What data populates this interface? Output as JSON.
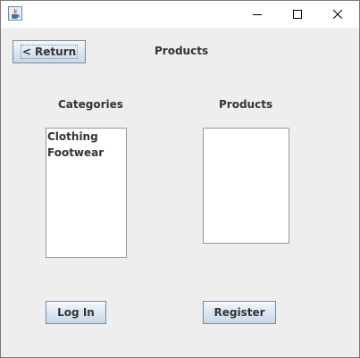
{
  "window": {
    "title": ""
  },
  "header": {
    "return_label": "< Return",
    "title": "Products"
  },
  "categories": {
    "label": "Categories",
    "items": [
      "Clothing",
      "Footwear"
    ]
  },
  "products": {
    "label": "Products",
    "items": []
  },
  "footer": {
    "login_label": "Log In",
    "register_label": "Register"
  },
  "icons": {
    "app": "java-app-icon",
    "minimize": "minimize-icon",
    "maximize": "maximize-icon",
    "close": "close-icon"
  }
}
